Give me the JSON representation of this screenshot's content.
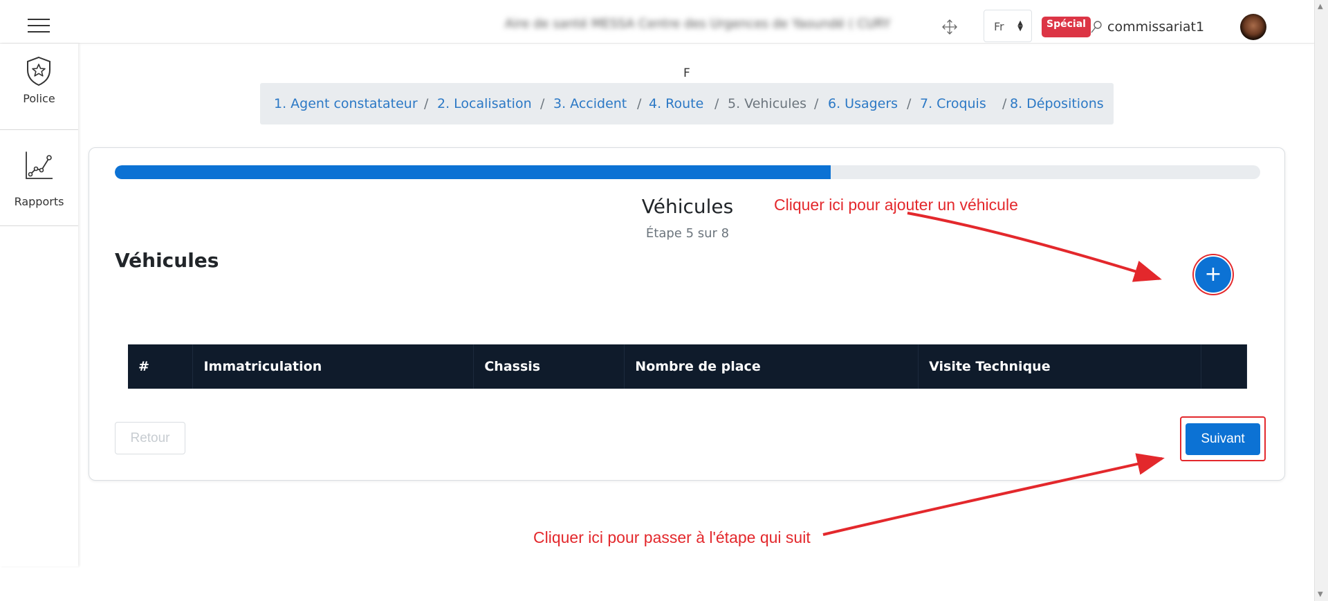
{
  "header": {
    "title_blurred": "Aire de santé MESSA Centre des Urgences de Yaoundé ( CURY",
    "language": "Fr",
    "badge": "Spécial",
    "username": "commissariat1"
  },
  "sidebar": {
    "items": [
      {
        "label": "Police",
        "icon": "police-badge-icon"
      },
      {
        "label": "Rapports",
        "icon": "line-chart-icon"
      }
    ]
  },
  "form": {
    "heading_letter": "F",
    "breadcrumb": [
      {
        "label": "1. Agent constatateur"
      },
      {
        "label": "2. Localisation"
      },
      {
        "label": "3. Accident"
      },
      {
        "label": "4. Route"
      },
      {
        "label": "5. Vehicules"
      },
      {
        "label": "6. Usagers"
      },
      {
        "label": "7. Croquis"
      },
      {
        "label": "8. Dépositions"
      }
    ],
    "breadcrumb_separator": "/",
    "progress_fraction": 0.625,
    "step_title": "Véhicules",
    "step_subtitle": "Étape 5 sur 8",
    "section_title": "Véhicules",
    "add_button": "+",
    "table_columns": [
      "#",
      "Immatriculation",
      "Chassis",
      "Nombre de place",
      "Visite Technique",
      ""
    ],
    "back_button": "Retour",
    "next_button": "Suivant"
  },
  "annotations": {
    "add_hint": "Cliquer ici pour ajouter un véhicule",
    "next_hint": "Cliquer ici pour passer à l'étape qui suit",
    "color": "#e3282c"
  },
  "colors": {
    "primary": "#0c72d4",
    "table_header": "#0f1b2b",
    "badge": "#dc3545"
  }
}
